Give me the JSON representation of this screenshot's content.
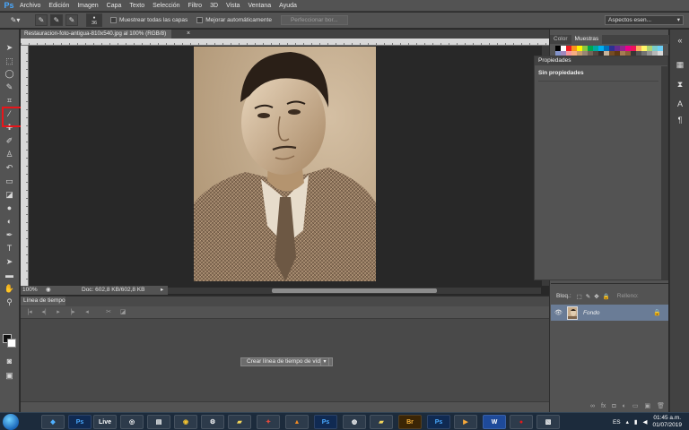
{
  "app": {
    "logo": "Ps"
  },
  "menubar": {
    "items": [
      "Archivo",
      "Edición",
      "Imagen",
      "Capa",
      "Texto",
      "Selección",
      "Filtro",
      "3D",
      "Vista",
      "Ventana",
      "Ayuda"
    ]
  },
  "options": {
    "brush_size": "36",
    "sample_all_layers": "Muestrear todas las capas",
    "auto_enhance": "Mejorar automáticamente",
    "refine_edge": "Perfeccionar bor...",
    "workspace": "Aspectos esen..."
  },
  "document": {
    "tab_title": "Restauracion-foto-antigua-810x540.jpg al 100% (RGB/8)",
    "zoom": "100%",
    "doc_size": "Doc: 602,8 KB/602,8 KB"
  },
  "timeline": {
    "tab_label": "Línea de tiempo",
    "create_button": "Crear línea de tiempo de vídeo"
  },
  "swatches_panel": {
    "tabs": [
      "Color",
      "Muestras"
    ],
    "colors": [
      "#000000",
      "#ffffff",
      "#ed1c24",
      "#f7941d",
      "#fff200",
      "#8dc63f",
      "#00a651",
      "#00a99d",
      "#00aeef",
      "#0072bc",
      "#2e3192",
      "#662d91",
      "#92278f",
      "#ec008c",
      "#ed145b",
      "#fbaf5d",
      "#fff568",
      "#acd373",
      "#7accc8",
      "#6dcff6",
      "#8393ca",
      "#a187be",
      "#f6989d",
      "#f9ad81",
      "#c69c6d",
      "#998675",
      "#736357",
      "#534741",
      "#37302d",
      "#c7b299",
      "#754c24",
      "#603913",
      "#a67c52",
      "#8c6239",
      "#363636",
      "#555555",
      "#737373",
      "#959595",
      "#b7b7b7",
      "#d9d9d9"
    ]
  },
  "properties_panel": {
    "title": "Propiedades",
    "subtitle": "Sin propiedades"
  },
  "layers_panel": {
    "lock_label": "Bloq.:",
    "fill_label": "Relleno:",
    "layer_name": "Fondo"
  },
  "taskbar": {
    "apps": [
      "Ps",
      "Live",
      "Ps",
      "Br",
      "Ps",
      "W"
    ],
    "language": "ES",
    "time": "01:45 a.m.",
    "date": "01/07/2019"
  }
}
